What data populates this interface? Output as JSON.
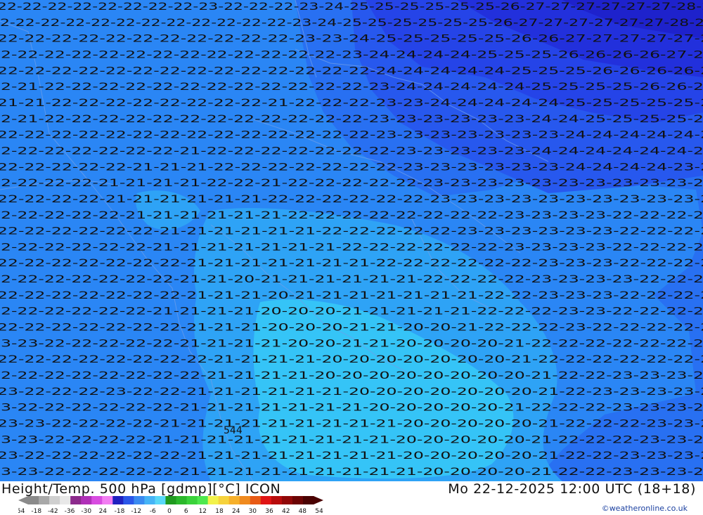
{
  "footer": {
    "title": "Height/Temp. 500 hPa [gdmp][°C] ICON",
    "datetime": "Mo 22-12-2025 12:00 UTC (18+18)",
    "credit": "©weatheronline.co.uk"
  },
  "legend": {
    "tick_labels": [
      "-54",
      "-18",
      "-42",
      "-36",
      "-30",
      "24",
      "-18",
      "-12",
      "-6",
      "0",
      "6",
      "12",
      "18",
      "24",
      "30",
      "36",
      "42",
      "48",
      "54"
    ],
    "colors": [
      "#8a8a8a",
      "#a8a8a8",
      "#cfcfcf",
      "#e8e8e8",
      "#8c2a8c",
      "#b030b8",
      "#d84ce0",
      "#f27df2",
      "#2020c0",
      "#2a56e8",
      "#3a8af0",
      "#46b4f6",
      "#58d8f8",
      "#1f9a1f",
      "#2bb82b",
      "#3ad23a",
      "#4ee84e",
      "#f2f24a",
      "#f6d23c",
      "#f6b02a",
      "#f08a1e",
      "#e85a14",
      "#e01414",
      "#b80c0c",
      "#900808",
      "#6c0404",
      "#4a0202"
    ]
  },
  "map": {
    "colors": {
      "band_20": "#35c4f7",
      "band_21": "#2ea3f6",
      "band_22": "#2a86f5",
      "band_23": "#2870f2",
      "band_24": "#2758ee",
      "band_25": "#2544e8",
      "band_26": "#2230dc",
      "band_27": "#1e22cc"
    },
    "special_label": "544",
    "rows": [
      {
        "text": "22-22-22-22-22-22-22-22-23-22-22-22-23-24-25-25-25-25-25-25-26-27-27-27-27-27-27-28-28"
      },
      {
        "text": "22-22-22-22-22-22-22-22-22-22-22-22-23-24-25-25-25-25-25-25-26-27-27-27-27-27-27-28-28"
      },
      {
        "text": "22-22-22-22-22-22-22-22-22-22-22-23-23-24-25-25-25-25-25-26-26-27-27-27-27-27-27"
      },
      {
        "text": "22-22-22-22-22-22-22-22-22-22-22-22-22-23-24-24-24-24-25-25-25-26-26-26-26-27-27"
      },
      {
        "text": "22-22-22-22-22-22-22-22-22-22-22-22-22-22-24-24-24-24-24-25-25-25-26-26-26-26-26"
      },
      {
        "text": "22-21-22-22-22-22-22-22-22-22-22-22-22-22-23-24-24-24-24-24-25-25-25-25-26-26-26"
      },
      {
        "text": "21-21-22-22-22-22-22-22-22-22-21-22-22-22-23-23-24-24-24-24-24-25-25-25-25-25-26"
      },
      {
        "text": "22-21-22-22-22-22-22-22-22-22-22-22-22-22-23-23-23-23-23-23-24-24-25-25-25-25-25"
      },
      {
        "text": "22-22-22-22-22-22-22-22-22-22-22-22-22-22-23-23-23-23-23-23-23-24-24-24-24-24-24"
      },
      {
        "text": "22-22-22-22-22-22-22-21-22-22-22-22-22-22-22-23-23-23-23-23-24-24-24-24-24-24-24"
      },
      {
        "text": "22-22-22-22-22-21-21-21-22-22-22-22-22-22-22-23-23-23-23-23-23-24-24-24-24-23-24"
      },
      {
        "text": "22-22-22-22-21-21-21-21-22-22-21-22-22-22-22-22-23-23-23-23-23-23-23-23-23-23-23"
      },
      {
        "text": "22-22-22-22-21-21-21-21-21-21-22-22-22-22-22-22-23-23-23-23-23-23-23-23-23-23-23"
      },
      {
        "text": "22-22-22-22-22-21-21-21-21-21-21-22-22-22-22-22-22-22-22-23-23-23-23-22-22-22-23"
      },
      {
        "text": "22-22-22-22-22-22-21-21-21-21-21-21-22-22-22-22-22-23-23-23-23-23-23-22-22-22-22"
      },
      {
        "text": "22-22-22-22-22-22-21-21-21-21-21-21-21-22-22-22-22-22-22-23-23-23-23-22-22-22-22"
      },
      {
        "text": "22-22-22-22-22-22-22-21-21-21-21-21-21-21-22-22-22-22-22-22-23-23-23-22-22-22-22"
      },
      {
        "text": "22-22-22-22-22-22-22-21-21-20-21-21-21-21-21-21-22-22-22-22-23-23-23-23-22-22-22"
      },
      {
        "text": "22-22-22-22-22-22-22-21-21-21-20-21-21-21-21-21-21-21-22-22-23-23-23-22-22-22-22"
      },
      {
        "text": "22-22-22-22-22-22-21-21-21-21-20-20-20-21-21-21-21-21-22-22-22-23-23-22-22-22-22"
      },
      {
        "text": "22-22-22-22-22-22-22-21-21-21-20-20-20-21-21-20-20-21-22-22-22-23-22-22-22-22-22"
      },
      {
        "text": "23-23-22-22-22-22-22-21-21-21-21-20-20-21-21-20-20-20-20-21-22-22-22-22-22-22-22"
      },
      {
        "text": "22-22-22-22-22-22-22-22-21-21-21-21-20-20-20-20-20-20-20-21-22-22-22-22-22-22-22"
      },
      {
        "text": "22-22-22-22-22-22-22-22-21-21-21-21-20-20-20-20-20-20-20-20-21-22-22-23-23-23-23"
      },
      {
        "text": "23-22-22-22-23-22-22-21-21-21-21-21-21-20-20-20-20-20-20-20-21-22-23-23-23-23-23"
      },
      {
        "text": "23-22-22-22-22-22-22-21-21-21-21-21-21-21-20-20-20-20-20-21-22-22-22-23-23-23-23"
      },
      {
        "text": "23-23-22-22-22-22-21-21-21-21-21-21-21-21-21-20-20-20-20-20-21-22-22-22-23-23-23"
      },
      {
        "text": "23-23-22-22-22-22-21-21-21-21-21-21-21-21-21-20-20-20-20-20-21-22-22-22-23-23-23"
      },
      {
        "text": "23-22-22-22-22-22-22-21-21-21-21-21-21-21-21-20-20-20-20-20-21-22-22-23-23-23-23"
      },
      {
        "text": "23-23-22-22-22-22-22-21-21-21-21-21-21-21-21-21-20-20-20-20-21-22-22-23-23-23-23"
      }
    ]
  }
}
